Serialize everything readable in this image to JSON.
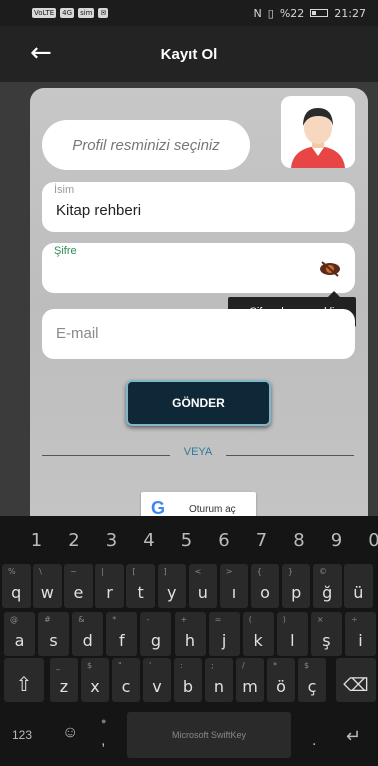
{
  "status_bar": {
    "left_icons": [
      "VoLTE",
      "4G",
      "sig",
      "sim",
      "mail"
    ],
    "battery_text": "%22",
    "time": "21:27"
  },
  "app_bar": {
    "title": "Kayıt Ol",
    "back_icon": "arrow-left-icon"
  },
  "form": {
    "profile_placeholder": "Profil resminizi seçiniz",
    "name": {
      "label": "İsim",
      "value": "Kitap rehberi"
    },
    "password": {
      "label": "Şifre",
      "value": ""
    },
    "tooltip": "Şifre alanı gerekli",
    "email": {
      "placeholder": "E-mail"
    },
    "submit_label": "GÖNDER",
    "divider_text": "VEYA",
    "google_label": "Oturum aç"
  },
  "colors": {
    "app_bar_bg": "#232323",
    "button_bg": "#0f2838",
    "divider_text": "#2f7a9a",
    "password_label": "#2e8b57"
  },
  "keyboard": {
    "numbers": [
      "1",
      "2",
      "3",
      "4",
      "5",
      "6",
      "7",
      "8",
      "9",
      "0"
    ],
    "row1": [
      {
        "main": "q",
        "sub": "%"
      },
      {
        "main": "w",
        "sub": "\\"
      },
      {
        "main": "e",
        "sub": "~"
      },
      {
        "main": "r",
        "sub": "|"
      },
      {
        "main": "t",
        "sub": "["
      },
      {
        "main": "y",
        "sub": "]"
      },
      {
        "main": "u",
        "sub": "<"
      },
      {
        "main": "ı",
        "sub": ">"
      },
      {
        "main": "o",
        "sub": "{"
      },
      {
        "main": "p",
        "sub": "}"
      },
      {
        "main": "ğ",
        "sub": "©"
      },
      {
        "main": "ü",
        "sub": ""
      }
    ],
    "row2": [
      {
        "main": "a",
        "sub": "@"
      },
      {
        "main": "s",
        "sub": "#"
      },
      {
        "main": "d",
        "sub": "&"
      },
      {
        "main": "f",
        "sub": "*"
      },
      {
        "main": "g",
        "sub": "-"
      },
      {
        "main": "h",
        "sub": "+"
      },
      {
        "main": "j",
        "sub": "="
      },
      {
        "main": "k",
        "sub": "("
      },
      {
        "main": "l",
        "sub": ")"
      },
      {
        "main": "ş",
        "sub": "×"
      },
      {
        "main": "i",
        "sub": "÷"
      }
    ],
    "row3": [
      {
        "main": "z",
        "sub": "_"
      },
      {
        "main": "x",
        "sub": "$"
      },
      {
        "main": "c",
        "sub": "\""
      },
      {
        "main": "v",
        "sub": "'"
      },
      {
        "main": "b",
        "sub": ":"
      },
      {
        "main": "n",
        "sub": ";"
      },
      {
        "main": "m",
        "sub": "/"
      },
      {
        "main": "ö",
        "sub": "*"
      },
      {
        "main": "ç",
        "sub": "$"
      }
    ],
    "num_switch": "123",
    "space_label": "Microsoft SwiftKey",
    "comma": ",",
    "period": "."
  }
}
